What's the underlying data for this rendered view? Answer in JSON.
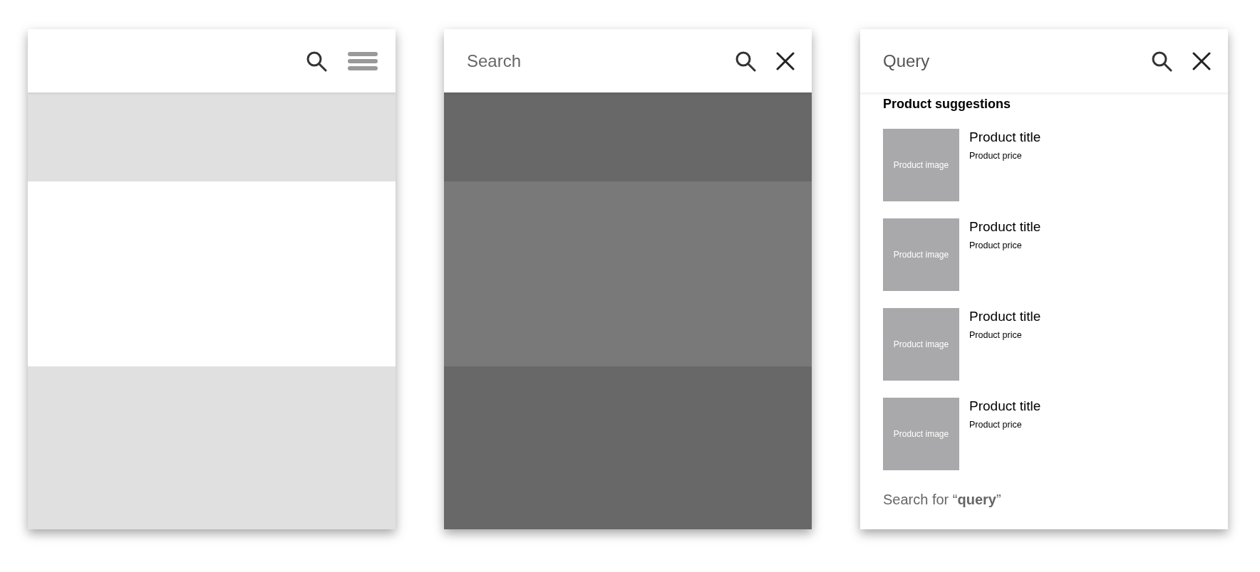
{
  "screens": [
    {
      "kind": "content",
      "dimmed": false,
      "header": {
        "actions": [
          {
            "kind": "search"
          },
          {
            "kind": "menu"
          }
        ]
      }
    },
    {
      "kind": "content",
      "dimmed": true,
      "header": {
        "placeholder": "Search",
        "actions": [
          {
            "kind": "search"
          },
          {
            "kind": "close"
          }
        ]
      }
    },
    {
      "kind": "suggestions",
      "header": {
        "value": "Query",
        "actions": [
          {
            "kind": "search"
          },
          {
            "kind": "close"
          }
        ]
      },
      "heading": "Product suggestions",
      "products": [
        {
          "image_label": "Product image",
          "title": "Product title",
          "price": "Product price"
        },
        {
          "image_label": "Product image",
          "title": "Product title",
          "price": "Product price"
        },
        {
          "image_label": "Product image",
          "title": "Product title",
          "price": "Product price"
        },
        {
          "image_label": "Product image",
          "title": "Product title",
          "price": "Product price"
        }
      ],
      "footer": "Search for “**query**”"
    }
  ]
}
